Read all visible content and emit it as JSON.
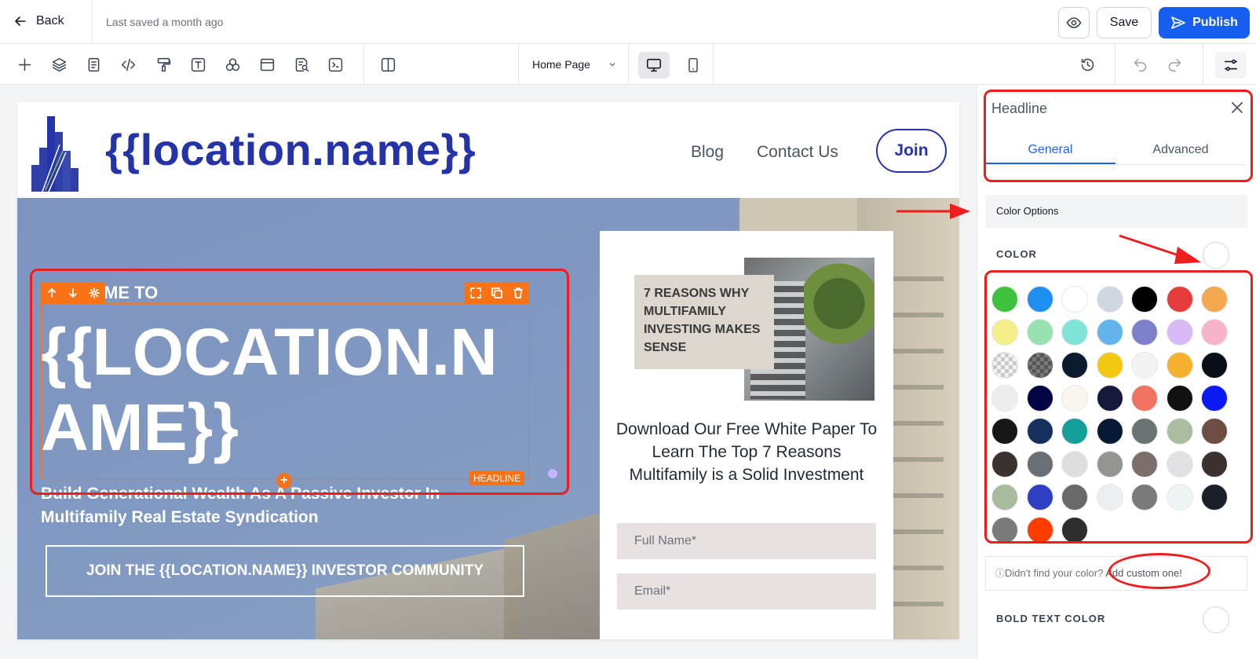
{
  "topbar": {
    "back_label": "Back",
    "saved_status": "Last saved a month ago",
    "save_label": "Save",
    "publish_label": "Publish"
  },
  "toolbar": {
    "page_select_value": "Home Page",
    "tools": [
      "plus-icon",
      "layers-icon",
      "pages-icon",
      "code-icon",
      "paint-roller-icon",
      "text-icon",
      "elements-icon",
      "browser-icon",
      "search-doc-icon",
      "terminal-icon",
      "columns-icon"
    ]
  },
  "site": {
    "title": "{{location.name}}",
    "nav": [
      "Blog",
      "Contact Us"
    ],
    "nav_join": "Join",
    "welcome": "ME TO",
    "headline": "{{LOCATION.NAME}}",
    "subheadline": "Build Generational Wealth As A Passive Investor In Multifamily Real Estate Syndication",
    "cta": "JOIN THE {{LOCATION.NAME}} INVESTOR COMMUNITY",
    "selection_label": "HEADLINE",
    "card": {
      "book_title": "7 REASONS WHY MULTIFAMILY INVESTING MAKES SENSE",
      "text": "Download Our Free White Paper To Learn The Top 7 Reasons Multifamily is a Solid Investment",
      "field_name_placeholder": "Full Name*",
      "field_email_placeholder": "Email*"
    }
  },
  "panel": {
    "title": "Headline",
    "tabs": [
      "General",
      "Advanced"
    ],
    "active_tab": "General",
    "section_title": "Color Options",
    "color_label": "COLOR",
    "custom_prompt": "Didn't find your color?",
    "custom_link": "Add custom one!",
    "bold_color_label": "BOLD TEXT COLOR",
    "swatches": [
      "#3ec23e",
      "#1e8ff0",
      "#ffffff",
      "#cfd8e0",
      "#000000",
      "#e53b3b",
      "#f4a94e",
      "#f5ef8a",
      "#98e2b0",
      "#7fe3d8",
      "#63b3ed",
      "#7c80c8",
      "#d8b9f5",
      "#f7b3c8",
      "checker-light",
      "checker-dark",
      "#0b1a2e",
      "#f2c811",
      "#f3f3f3",
      "#f7b12e",
      "#0a0f17",
      "#ededed",
      "#020445",
      "#faf5ef",
      "#151a3d",
      "#f07260",
      "#111111",
      "#0b1af5",
      "#171717",
      "#16305e",
      "#159f9a",
      "#081a33",
      "#6a7273",
      "#aabd9f",
      "#6e4e42",
      "#3a322f",
      "#686f75",
      "#dedede",
      "#939590",
      "#7d6e6e",
      "#e0e1e3",
      "#3b322f",
      "#a8bb9c",
      "#2f3fc4",
      "#696969",
      "#eceff2",
      "#7a7b79",
      "#eef3f6",
      "#1a1f28",
      "#7a7a7a",
      "#ff3d00",
      "#2d2d2d"
    ]
  }
}
